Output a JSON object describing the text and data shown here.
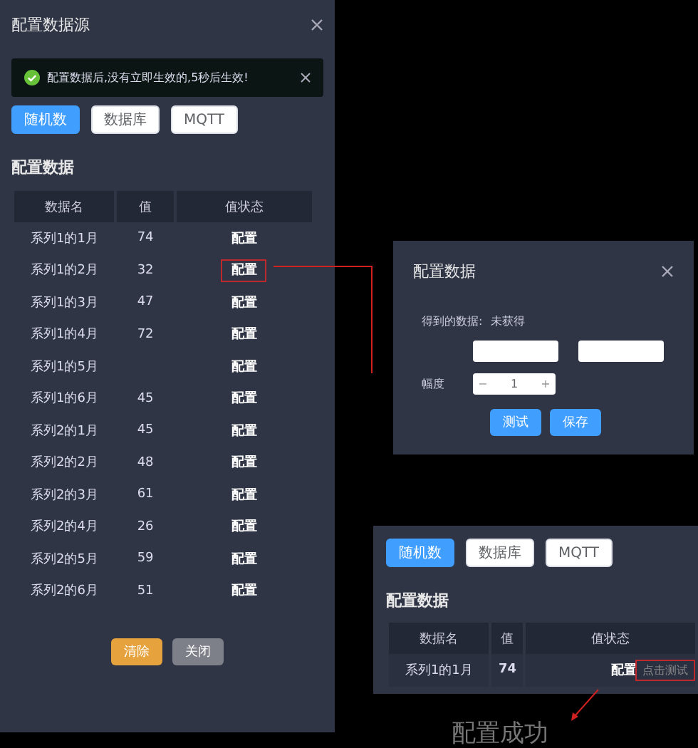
{
  "config_panel": {
    "title": "配置数据源",
    "alert": "配置数据后,没有立即生效的,5秒后生效!",
    "tabs": [
      {
        "label": "随机数",
        "selected": true
      },
      {
        "label": "数据库",
        "selected": false
      },
      {
        "label": "MQTT",
        "selected": false
      }
    ],
    "section": "配置数据",
    "columns": [
      "数据名",
      "值",
      "值状态"
    ],
    "rows": [
      {
        "name": "系列1的1月",
        "value": "74",
        "status": "配置",
        "highlighted": false
      },
      {
        "name": "系列1的2月",
        "value": "32",
        "status": "配置",
        "highlighted": true
      },
      {
        "name": "系列1的3月",
        "value": "47",
        "status": "配置",
        "highlighted": false
      },
      {
        "name": "系列1的4月",
        "value": "72",
        "status": "配置",
        "highlighted": false
      },
      {
        "name": "系列1的5月",
        "status": "配置",
        "highlighted": false
      },
      {
        "name": "系列1的6月",
        "value": "45",
        "status": "配置",
        "highlighted": false
      },
      {
        "name": "系列2的1月",
        "value": "45",
        "status": "配置",
        "highlighted": false
      },
      {
        "name": "系列2的2月",
        "value": "48",
        "status": "配置",
        "highlighted": false
      },
      {
        "name": "系列2的3月",
        "value": "61",
        "status": "配置",
        "highlighted": false
      },
      {
        "name": "系列2的4月",
        "value": "26",
        "status": "配置",
        "highlighted": false
      },
      {
        "name": "系列2的5月",
        "value": "59",
        "status": "配置",
        "highlighted": false
      },
      {
        "name": "系列2的6月",
        "value": "51",
        "status": "配置",
        "highlighted": false
      }
    ],
    "buttons": [
      {
        "label": "清除",
        "kind": "warning"
      },
      {
        "label": "关闭",
        "kind": "neutral"
      }
    ]
  },
  "config_dialog": {
    "title": "配置数据",
    "result_label": "得到的数据:",
    "result_value": "未获得",
    "step_label": "幅度",
    "step_value": "1",
    "decrement": "−",
    "increment": "+",
    "buttons": [
      {
        "label": "测试",
        "kind": "primary"
      },
      {
        "label": "保存",
        "kind": "primary"
      }
    ]
  },
  "preview_panel": {
    "tabs": [
      {
        "label": "随机数",
        "selected": true
      },
      {
        "label": "数据库",
        "selected": false
      },
      {
        "label": "MQTT",
        "selected": false
      }
    ],
    "section": "配置数据",
    "columns": [
      "数据名",
      "值",
      "值状态"
    ],
    "rows": [
      {
        "name": "系列1的1月",
        "value": "74",
        "status": "配置",
        "action": "点击测试",
        "highlighted": true
      }
    ]
  },
  "annotation": "配置成功"
}
